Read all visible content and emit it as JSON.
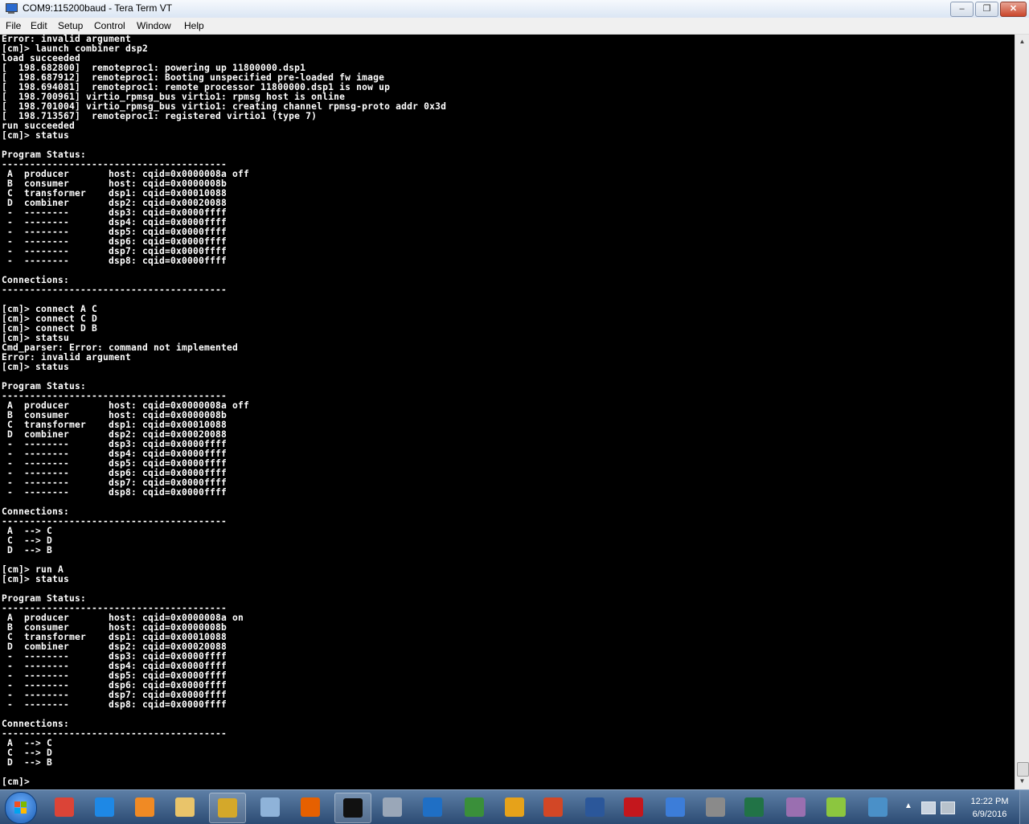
{
  "window": {
    "title": "COM9:115200baud - Tera Term VT",
    "minimize_glyph": "–",
    "maximize_glyph": "❐",
    "close_glyph": "✕"
  },
  "menu": [
    "File",
    "Edit",
    "Setup",
    "Control",
    "Window",
    "Help"
  ],
  "terminal": {
    "lines": [
      "Error: invalid argument",
      "[cm]> launch combiner dsp2",
      "load succeeded",
      "[  198.682800]  remoteproc1: powering up 11800000.dsp1",
      "[  198.687912]  remoteproc1: Booting unspecified pre-loaded fw image",
      "[  198.694081]  remoteproc1: remote processor 11800000.dsp1 is now up",
      "[  198.700961] virtio_rpmsg_bus virtio1: rpmsg host is online",
      "[  198.701004] virtio_rpmsg_bus virtio1: creating channel rpmsg-proto addr 0x3d",
      "[  198.713567]  remoteproc1: registered virtio1 (type 7)",
      "run succeeded",
      "[cm]> status",
      "",
      "Program Status:",
      "----------------------------------------",
      " A  producer       host: cqid=0x0000008a off",
      " B  consumer       host: cqid=0x0000008b",
      " C  transformer    dsp1: cqid=0x00010088",
      " D  combiner       dsp2: cqid=0x00020088",
      " -  --------       dsp3: cqid=0x0000ffff",
      " -  --------       dsp4: cqid=0x0000ffff",
      " -  --------       dsp5: cqid=0x0000ffff",
      " -  --------       dsp6: cqid=0x0000ffff",
      " -  --------       dsp7: cqid=0x0000ffff",
      " -  --------       dsp8: cqid=0x0000ffff",
      "",
      "Connections:",
      "----------------------------------------",
      "",
      "[cm]> connect A C",
      "[cm]> connect C D",
      "[cm]> connect D B",
      "[cm]> statsu",
      "Cmd_parser: Error: command not implemented",
      "Error: invalid argument",
      "[cm]> status",
      "",
      "Program Status:",
      "----------------------------------------",
      " A  producer       host: cqid=0x0000008a off",
      " B  consumer       host: cqid=0x0000008b",
      " C  transformer    dsp1: cqid=0x00010088",
      " D  combiner       dsp2: cqid=0x00020088",
      " -  --------       dsp3: cqid=0x0000ffff",
      " -  --------       dsp4: cqid=0x0000ffff",
      " -  --------       dsp5: cqid=0x0000ffff",
      " -  --------       dsp6: cqid=0x0000ffff",
      " -  --------       dsp7: cqid=0x0000ffff",
      " -  --------       dsp8: cqid=0x0000ffff",
      "",
      "Connections:",
      "----------------------------------------",
      " A  --> C",
      " C  --> D",
      " D  --> B",
      "",
      "[cm]> run A",
      "[cm]> status",
      "",
      "Program Status:",
      "----------------------------------------",
      " A  producer       host: cqid=0x0000008a on",
      " B  consumer       host: cqid=0x0000008b",
      " C  transformer    dsp1: cqid=0x00010088",
      " D  combiner       dsp2: cqid=0x00020088",
      " -  --------       dsp3: cqid=0x0000ffff",
      " -  --------       dsp4: cqid=0x0000ffff",
      " -  --------       dsp5: cqid=0x0000ffff",
      " -  --------       dsp6: cqid=0x0000ffff",
      " -  --------       dsp7: cqid=0x0000ffff",
      " -  --------       dsp8: cqid=0x0000ffff",
      "",
      "Connections:",
      "----------------------------------------",
      " A  --> C",
      " C  --> D",
      " D  --> B",
      "",
      "[cm]>"
    ]
  },
  "taskbar": {
    "pinned": [
      {
        "name": "chrome",
        "color": "#db4437"
      },
      {
        "name": "internet-explorer",
        "color": "#1e88e5"
      },
      {
        "name": "media-player",
        "color": "#f08a24"
      },
      {
        "name": "file-explorer",
        "color": "#e9c46a"
      },
      {
        "name": "tera-term",
        "color": "#d4a82a",
        "active": true
      },
      {
        "name": "paint",
        "color": "#8fb3d9"
      },
      {
        "name": "firefox",
        "color": "#e66000"
      },
      {
        "name": "command-prompt",
        "color": "#111111",
        "active": true
      },
      {
        "name": "calculator",
        "color": "#9aa7b8"
      },
      {
        "name": "lync",
        "color": "#1f6fc5"
      },
      {
        "name": "project",
        "color": "#3a8f3a"
      },
      {
        "name": "outlook",
        "color": "#e6a21a"
      },
      {
        "name": "powerpoint",
        "color": "#d24726"
      },
      {
        "name": "word",
        "color": "#2b579a"
      },
      {
        "name": "acrobat",
        "color": "#c4171d"
      },
      {
        "name": "wordpad",
        "color": "#3c7dd9"
      },
      {
        "name": "virtualbox",
        "color": "#8a8a8a"
      },
      {
        "name": "excel",
        "color": "#217346"
      },
      {
        "name": "winrar",
        "color": "#9a6fb0"
      },
      {
        "name": "network-tool",
        "color": "#8cc63f"
      },
      {
        "name": "photo-viewer",
        "color": "#4a90c8"
      }
    ],
    "clock_time": "12:22 PM",
    "clock_date": "6/9/2016"
  }
}
